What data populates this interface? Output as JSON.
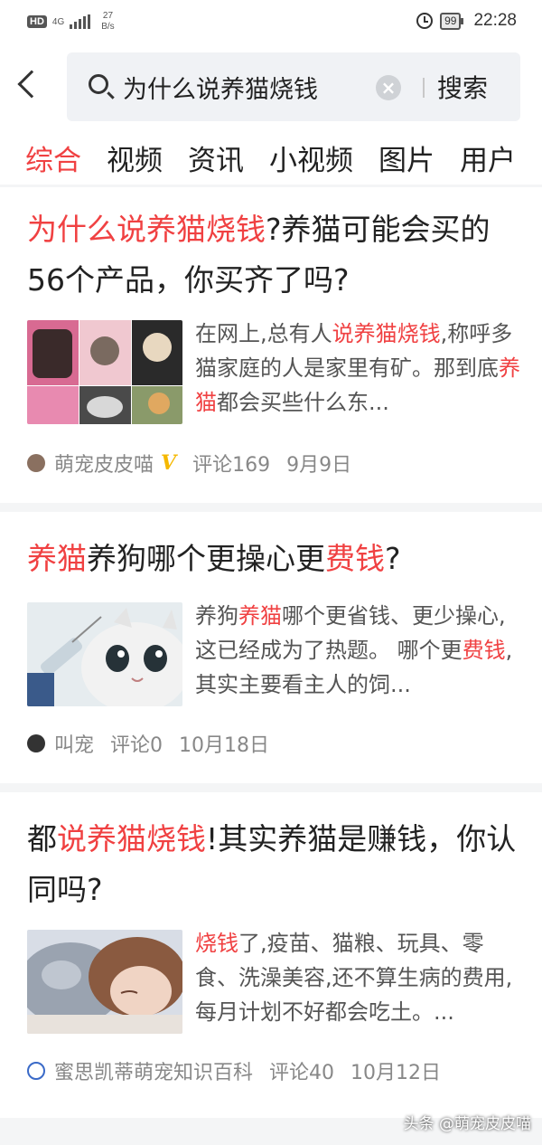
{
  "status_bar": {
    "network_type": "HD",
    "signal_label": "4G",
    "net_speed_value": "27",
    "net_speed_unit": "B/s",
    "battery": "99",
    "time": "22:28"
  },
  "search": {
    "query": "为什么说养猫烧钱",
    "button_label": "搜索"
  },
  "tabs": [
    {
      "label": "综合",
      "active": true
    },
    {
      "label": "视频",
      "active": false
    },
    {
      "label": "资讯",
      "active": false
    },
    {
      "label": "小视频",
      "active": false
    },
    {
      "label": "图片",
      "active": false
    },
    {
      "label": "用户",
      "active": false
    }
  ],
  "articles": [
    {
      "title_parts": [
        "为什么说养猫烧钱",
        "?养猫可能会买的56个产品，你买齐了吗?"
      ],
      "snippet_parts": [
        "在网上,总有人",
        "说养猫烧钱",
        ",称呼多猫家庭的人是家里有矿。那到底",
        "养猫",
        "都会买些什么东..."
      ],
      "author": "萌宠皮皮喵",
      "verified_badge": "V",
      "comments": "评论169",
      "date": "9月9日"
    },
    {
      "title_parts": [
        "养猫",
        "养狗哪个更操心更",
        "费钱",
        "?"
      ],
      "snippet_parts": [
        "养狗",
        "养猫",
        "哪个更省钱、更少操心,这已经成为了热题。 哪个更",
        "费钱",
        ",其实主要看主人的饲..."
      ],
      "author": "叫宠",
      "comments": "评论0",
      "date": "10月18日"
    },
    {
      "title_parts": [
        "都",
        "说养猫烧钱",
        "!其实养猫是赚钱，你认同吗?"
      ],
      "snippet_parts": [
        "烧钱",
        "了,疫苗、猫粮、玩具、零食、洗澡美容,还不算生病的费用,每月计划不好都会吃土。..."
      ],
      "author": "蜜思凯蒂萌宠知识百科",
      "comments": "评论40",
      "date": "10月12日"
    }
  ],
  "watermark": "头条 @萌宠皮皮喵",
  "colors": {
    "highlight": "#f04142",
    "text": "#222222",
    "meta": "#888888",
    "search_bg": "#f0f2f5",
    "separator": "#f4f5f6"
  }
}
